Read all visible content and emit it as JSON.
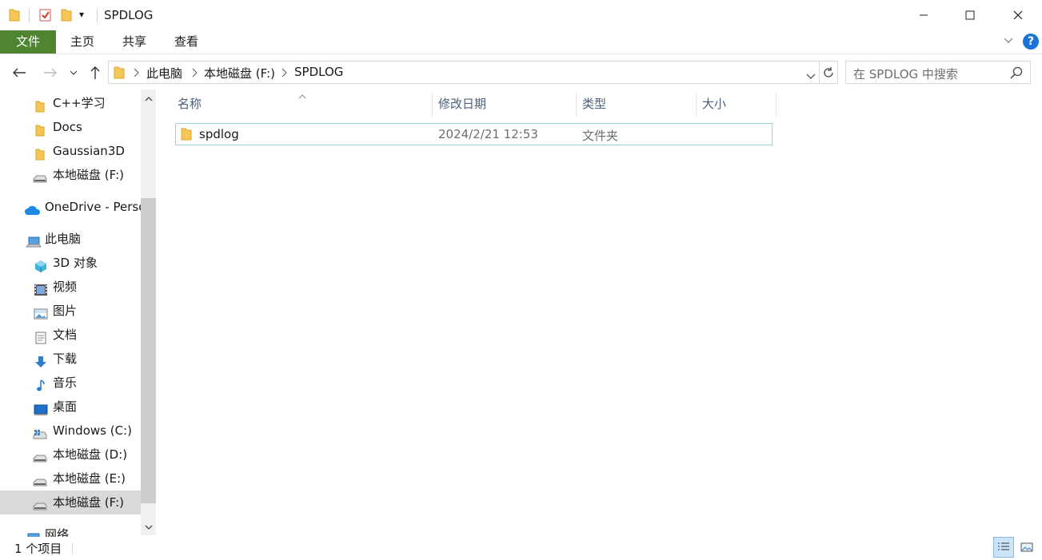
{
  "window": {
    "title": "SPDLOG",
    "qat_dropdown": "▾",
    "controls": {
      "minimize": "—",
      "maximize": "☐",
      "close": "✕"
    }
  },
  "ribbon": {
    "tabs": [
      "文件",
      "主页",
      "共享",
      "查看"
    ],
    "help": "?"
  },
  "address": {
    "crumbs": [
      "此电脑",
      "本地磁盘 (F:)",
      "SPDLOG"
    ]
  },
  "search": {
    "placeholder": "在 SPDLOG 中搜索"
  },
  "nav": {
    "items": [
      {
        "label": "C++学习",
        "icon": "folder-icon"
      },
      {
        "label": "Docs",
        "icon": "folder-icon"
      },
      {
        "label": "Gaussian3D",
        "icon": "folder-icon"
      },
      {
        "label": "本地磁盘 (F:)",
        "icon": "drive-icon"
      },
      {
        "label": "OneDrive - Perso",
        "icon": "onedrive-icon"
      },
      {
        "label": "此电脑",
        "icon": "this-pc-icon"
      },
      {
        "label": "3D 对象",
        "icon": "3d-objects-icon"
      },
      {
        "label": "视频",
        "icon": "video-icon"
      },
      {
        "label": "图片",
        "icon": "pictures-icon"
      },
      {
        "label": "文档",
        "icon": "documents-icon"
      },
      {
        "label": "下载",
        "icon": "download-icon"
      },
      {
        "label": "音乐",
        "icon": "music-icon"
      },
      {
        "label": "桌面",
        "icon": "desktop-icon"
      },
      {
        "label": "Windows (C:)",
        "icon": "windows-drive-icon"
      },
      {
        "label": "本地磁盘 (D:)",
        "icon": "drive-icon"
      },
      {
        "label": "本地磁盘 (E:)",
        "icon": "drive-icon"
      },
      {
        "label": "本地磁盘 (F:)",
        "icon": "drive-icon",
        "selected": true
      },
      {
        "label": "网络",
        "icon": "network-icon"
      }
    ]
  },
  "columns": {
    "name": "名称",
    "modified": "修改日期",
    "type": "类型",
    "size": "大小"
  },
  "files": [
    {
      "name": "spdlog",
      "modified": "2024/2/21 12:53",
      "type": "文件夹",
      "size": ""
    }
  ],
  "status": {
    "count": "1 个项目"
  },
  "colors": {
    "file_tab": "#4f8531",
    "folder": "#f3c655",
    "selection": "#99d1e0",
    "help": "#1a73d9"
  }
}
